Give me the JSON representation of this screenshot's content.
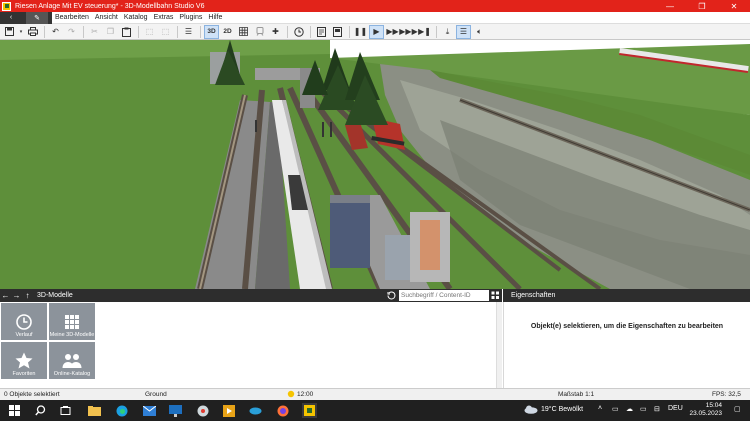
{
  "window": {
    "title": "Riesen Anlage Mit EV steuerung* - 3D-Modellbahn Studio V6",
    "minimize": "—",
    "restore": "❐",
    "close": "✕"
  },
  "menu": {
    "back_icon": "‹",
    "edit_icon": "✎",
    "items": [
      "Bearbeiten",
      "Ansicht",
      "Katalog",
      "Extras",
      "Plugins",
      "Hilfe"
    ]
  },
  "toolbar": {
    "btn_3d": "3D",
    "btn_2d": "2D"
  },
  "catalog": {
    "title": "3D-Modelle",
    "search_placeholder": "Suchbegriff / Content-ID",
    "tiles": [
      {
        "label": "Verlauf",
        "icon": "clock-icon"
      },
      {
        "label": "Meine 3D-Modelle",
        "icon": "grid-icon"
      },
      {
        "label": "Favoriten",
        "icon": "star-icon"
      },
      {
        "label": "Online-Katalog",
        "icon": "people-icon"
      }
    ]
  },
  "properties": {
    "title": "Eigenschaften",
    "message": "Objekt(e) selektieren, um die Eigenschaften zu bearbeiten"
  },
  "status": {
    "selection": "0 Objekte selektiert",
    "layer": "Ground",
    "time": "12:00",
    "scale": "Maßstab 1:1",
    "fps": "FPS: 32,5"
  },
  "taskbar": {
    "weather": "19°C  Bewölkt",
    "lang": "DEU",
    "time": "15:04",
    "date": "23.05.2023"
  },
  "colors": {
    "titlebar": "#e2231a",
    "dark_panel": "#2d2d2d",
    "tile": "#8c939b",
    "grass": "#5e8f3a",
    "sky": "#ffffff"
  }
}
